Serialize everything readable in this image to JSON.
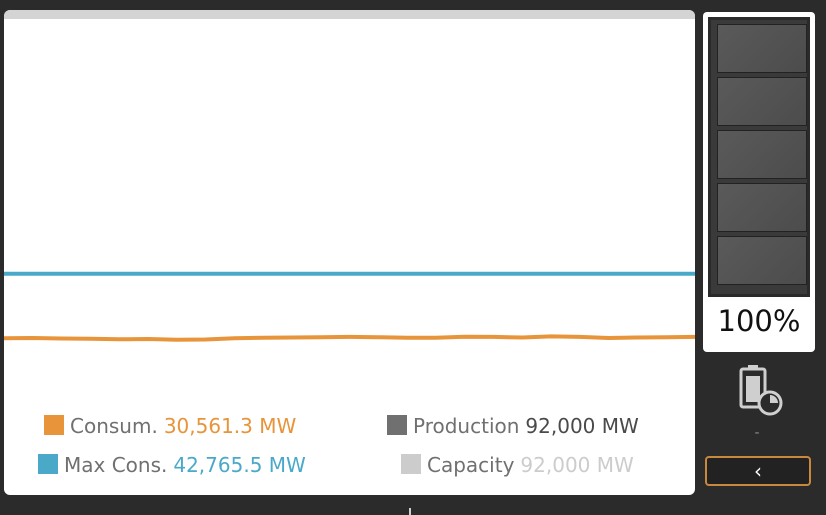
{
  "legend": {
    "consumption": {
      "label": "Consum.",
      "value": "30,561.3 MW",
      "color": "#e8943a"
    },
    "production": {
      "label": "Production",
      "value": "92,000 MW",
      "color": "#707070"
    },
    "max_cons": {
      "label": "Max Cons.",
      "value": "42,765.5 MW",
      "color": "#4aa9c9"
    },
    "capacity": {
      "label": "Capacity",
      "value": "92,000 MW",
      "color": "#cccccc"
    }
  },
  "chart_data": {
    "type": "line",
    "series": [
      {
        "name": "Max Cons.",
        "values": [
          42765.5,
          42765.5,
          42765.5,
          42765.5,
          42765.5,
          42765.5,
          42765.5,
          42765.5,
          42765.5,
          42765.5,
          42765.5,
          42765.5,
          42765.5,
          42765.5,
          42765.5,
          42765.5,
          42765.5,
          42765.5,
          42765.5,
          42765.5,
          42765.5,
          42765.5,
          42765.5,
          42765.5,
          42765.5
        ]
      },
      {
        "name": "Consum.",
        "values": [
          30300,
          30350,
          30250,
          30200,
          30100,
          30150,
          30000,
          30050,
          30300,
          30400,
          30450,
          30500,
          30550,
          30500,
          30400,
          30400,
          30600,
          30550,
          30450,
          30650,
          30550,
          30350,
          30450,
          30500,
          30561.3
        ]
      }
    ],
    "ylim": [
      0,
      92000
    ]
  },
  "storage": {
    "percent": "100%",
    "level": 1.0,
    "cells": 5
  },
  "status_dash": "-",
  "back_button": {
    "label": "‹"
  }
}
